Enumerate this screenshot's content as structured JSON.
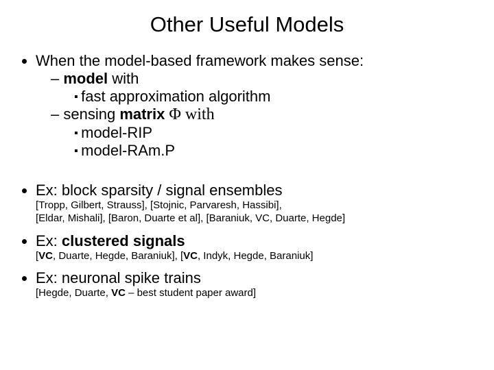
{
  "title": "Other Useful Models",
  "b1": {
    "lead": "When the model-based framework makes sense:",
    "s1a": "model",
    "s1b": " with",
    "s1_sub": "fast approximation algorithm",
    "s2a": "sensing ",
    "s2b": "matrix",
    "s2c": "  Φ  with",
    "s2_sub1": "model-RIP",
    "s2_sub2": "model-RAm.P"
  },
  "ex1": {
    "head": "Ex:  block sparsity / signal ensembles",
    "cite": "[Tropp, Gilbert, Strauss], [Stojnic, Parvaresh, Hassibi],\n[Eldar, Mishali], [Baron, Duarte et al], [Baraniuk, VC, Duarte, Hegde]"
  },
  "ex2": {
    "head_a": "Ex:  ",
    "head_b": "clustered signals",
    "cite_a": "[",
    "cite_b": "VC",
    "cite_c": ", Duarte, Hegde, Baraniuk], [",
    "cite_d": "VC",
    "cite_e": ", Indyk, Hegde, Baraniuk]"
  },
  "ex3": {
    "head": "Ex:  neuronal spike trains",
    "cite_a": "[Hegde, Duarte, ",
    "cite_b": "VC",
    "cite_c": " – best student paper award]"
  }
}
